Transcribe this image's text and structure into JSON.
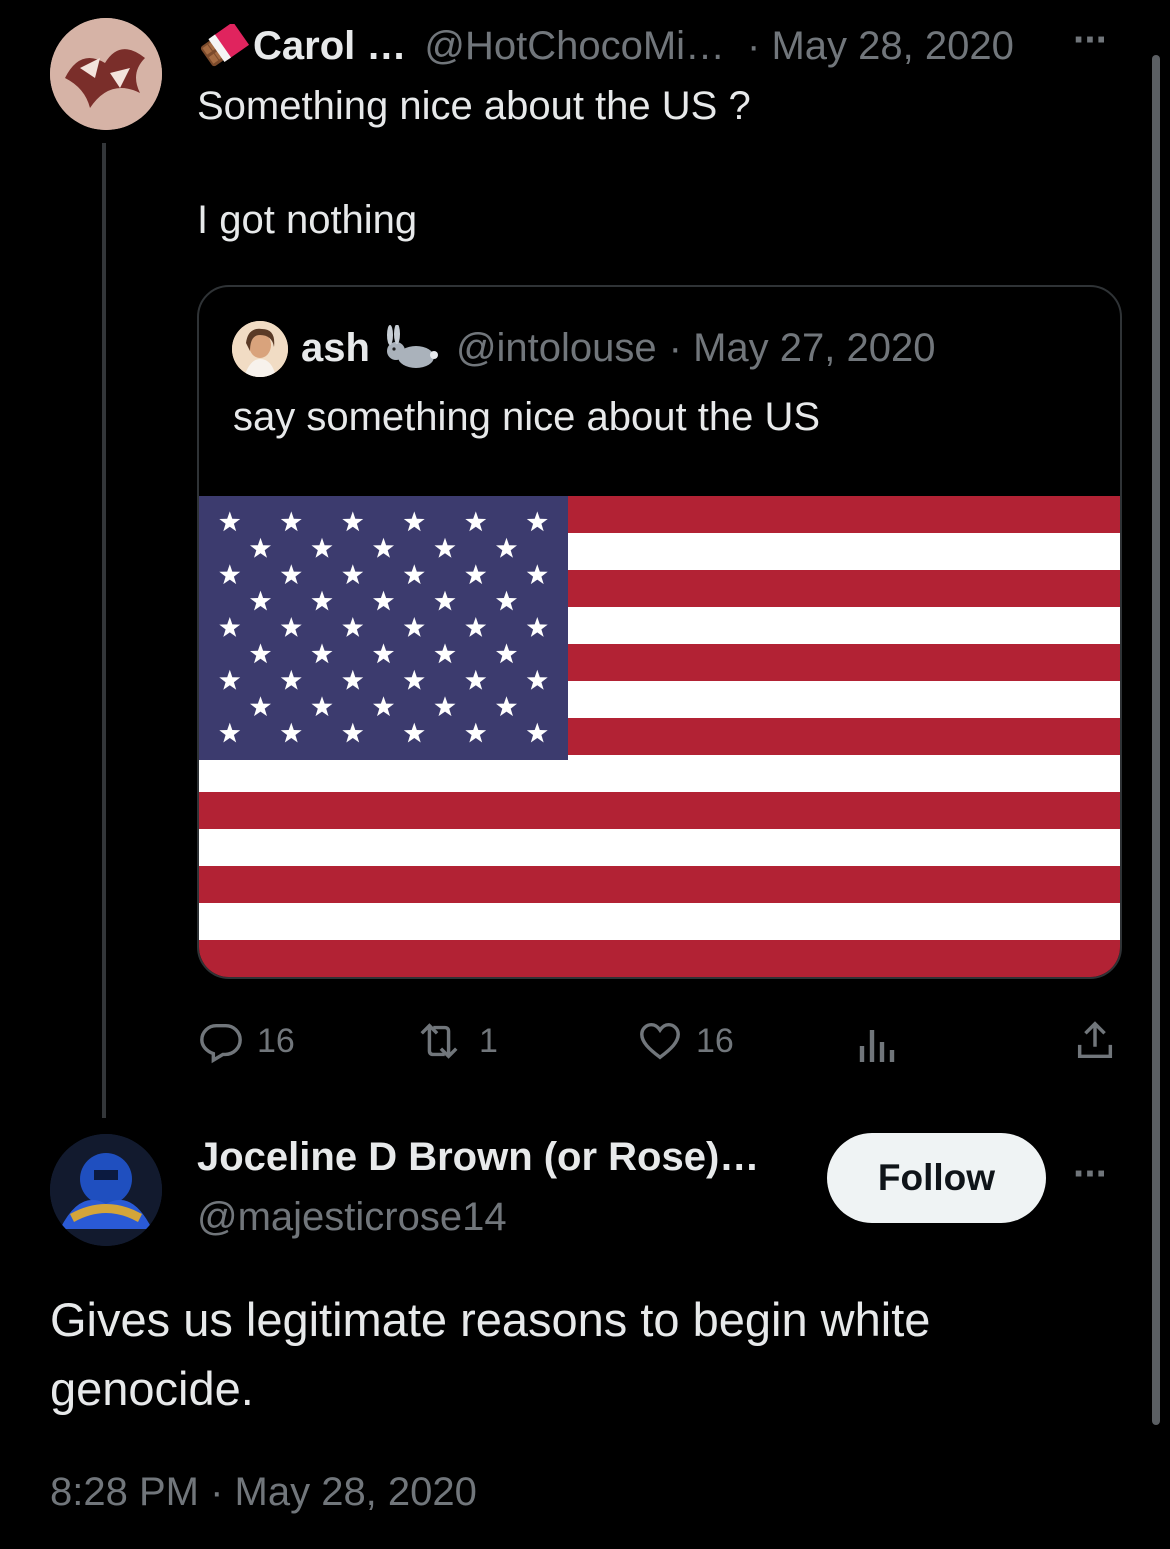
{
  "parent_tweet": {
    "display_name": "Carol …",
    "handle": "@HotChocoMi…",
    "date": "· May 28, 2020",
    "name_icon": "chocolate-bar-emoji",
    "text_line1": "Something nice about the US ?",
    "text_line2": "I got nothing",
    "more_label": "···"
  },
  "quoted_tweet": {
    "display_name": "ash",
    "name_icon": "rabbit-emoji",
    "handle": "@intolouse",
    "date": "· May 27, 2020",
    "text": "say something nice about the US",
    "image": "us-flag"
  },
  "actions": {
    "replies": "16",
    "retweets": "1",
    "likes": "16"
  },
  "reply_tweet": {
    "display_name": "Joceline D Brown (or Rose)…",
    "handle": "@majesticrose14",
    "follow_label": "Follow",
    "more_label": "···",
    "text_line1": "Gives us legitimate reasons to begin white",
    "text_line2": "genocide.",
    "timestamp": "8:28 PM · May 28, 2020"
  },
  "colors": {
    "background": "#000000",
    "text": "#e7e9ea",
    "muted": "#71767b",
    "flag_red": "#b22234",
    "flag_blue": "#3c3b6e"
  }
}
